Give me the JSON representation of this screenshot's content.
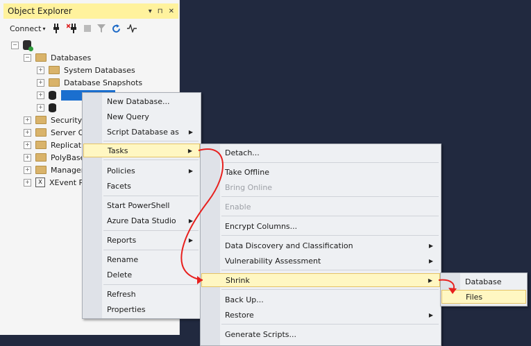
{
  "object_explorer": {
    "title": "Object Explorer",
    "title_controls": [
      "▾",
      "⊓",
      "✕"
    ],
    "toolbar": {
      "connect_label": "Connect",
      "connect_caret": "▾"
    },
    "tree": {
      "databases_label": "Databases",
      "system_databases_label": "System Databases",
      "database_snapshots_label": "Database Snapshots",
      "security_label": "Security",
      "server_objects_label": "Server Ob",
      "replication_label": "Replicatio",
      "polybase_label": "PolyBase",
      "management_label": "Managen",
      "xevent_label": "XEvent Pr"
    }
  },
  "context_menu": {
    "items": {
      "new_database": "New Database...",
      "new_query": "New Query",
      "script_database_as": "Script Database as",
      "tasks": "Tasks",
      "policies": "Policies",
      "facets": "Facets",
      "start_powershell": "Start PowerShell",
      "azure_data_studio": "Azure Data Studio",
      "reports": "Reports",
      "rename": "Rename",
      "delete": "Delete",
      "refresh": "Refresh",
      "properties": "Properties"
    },
    "submenu_arrow": "▶"
  },
  "tasks_menu": {
    "items": {
      "detach": "Detach...",
      "take_offline": "Take Offline",
      "bring_online": "Bring Online",
      "enable": "Enable",
      "encrypt_columns": "Encrypt Columns...",
      "data_discovery": "Data Discovery and Classification",
      "vulnerability_assessment": "Vulnerability Assessment",
      "shrink": "Shrink",
      "back_up": "Back Up...",
      "restore": "Restore",
      "generate_scripts": "Generate Scripts..."
    }
  },
  "shrink_menu": {
    "items": {
      "database": "Database",
      "files": "Files"
    }
  },
  "colors": {
    "background": "#21293f",
    "highlight": "#fff7c2",
    "selection": "#1b6fcf",
    "arrow": "#e8201e"
  }
}
